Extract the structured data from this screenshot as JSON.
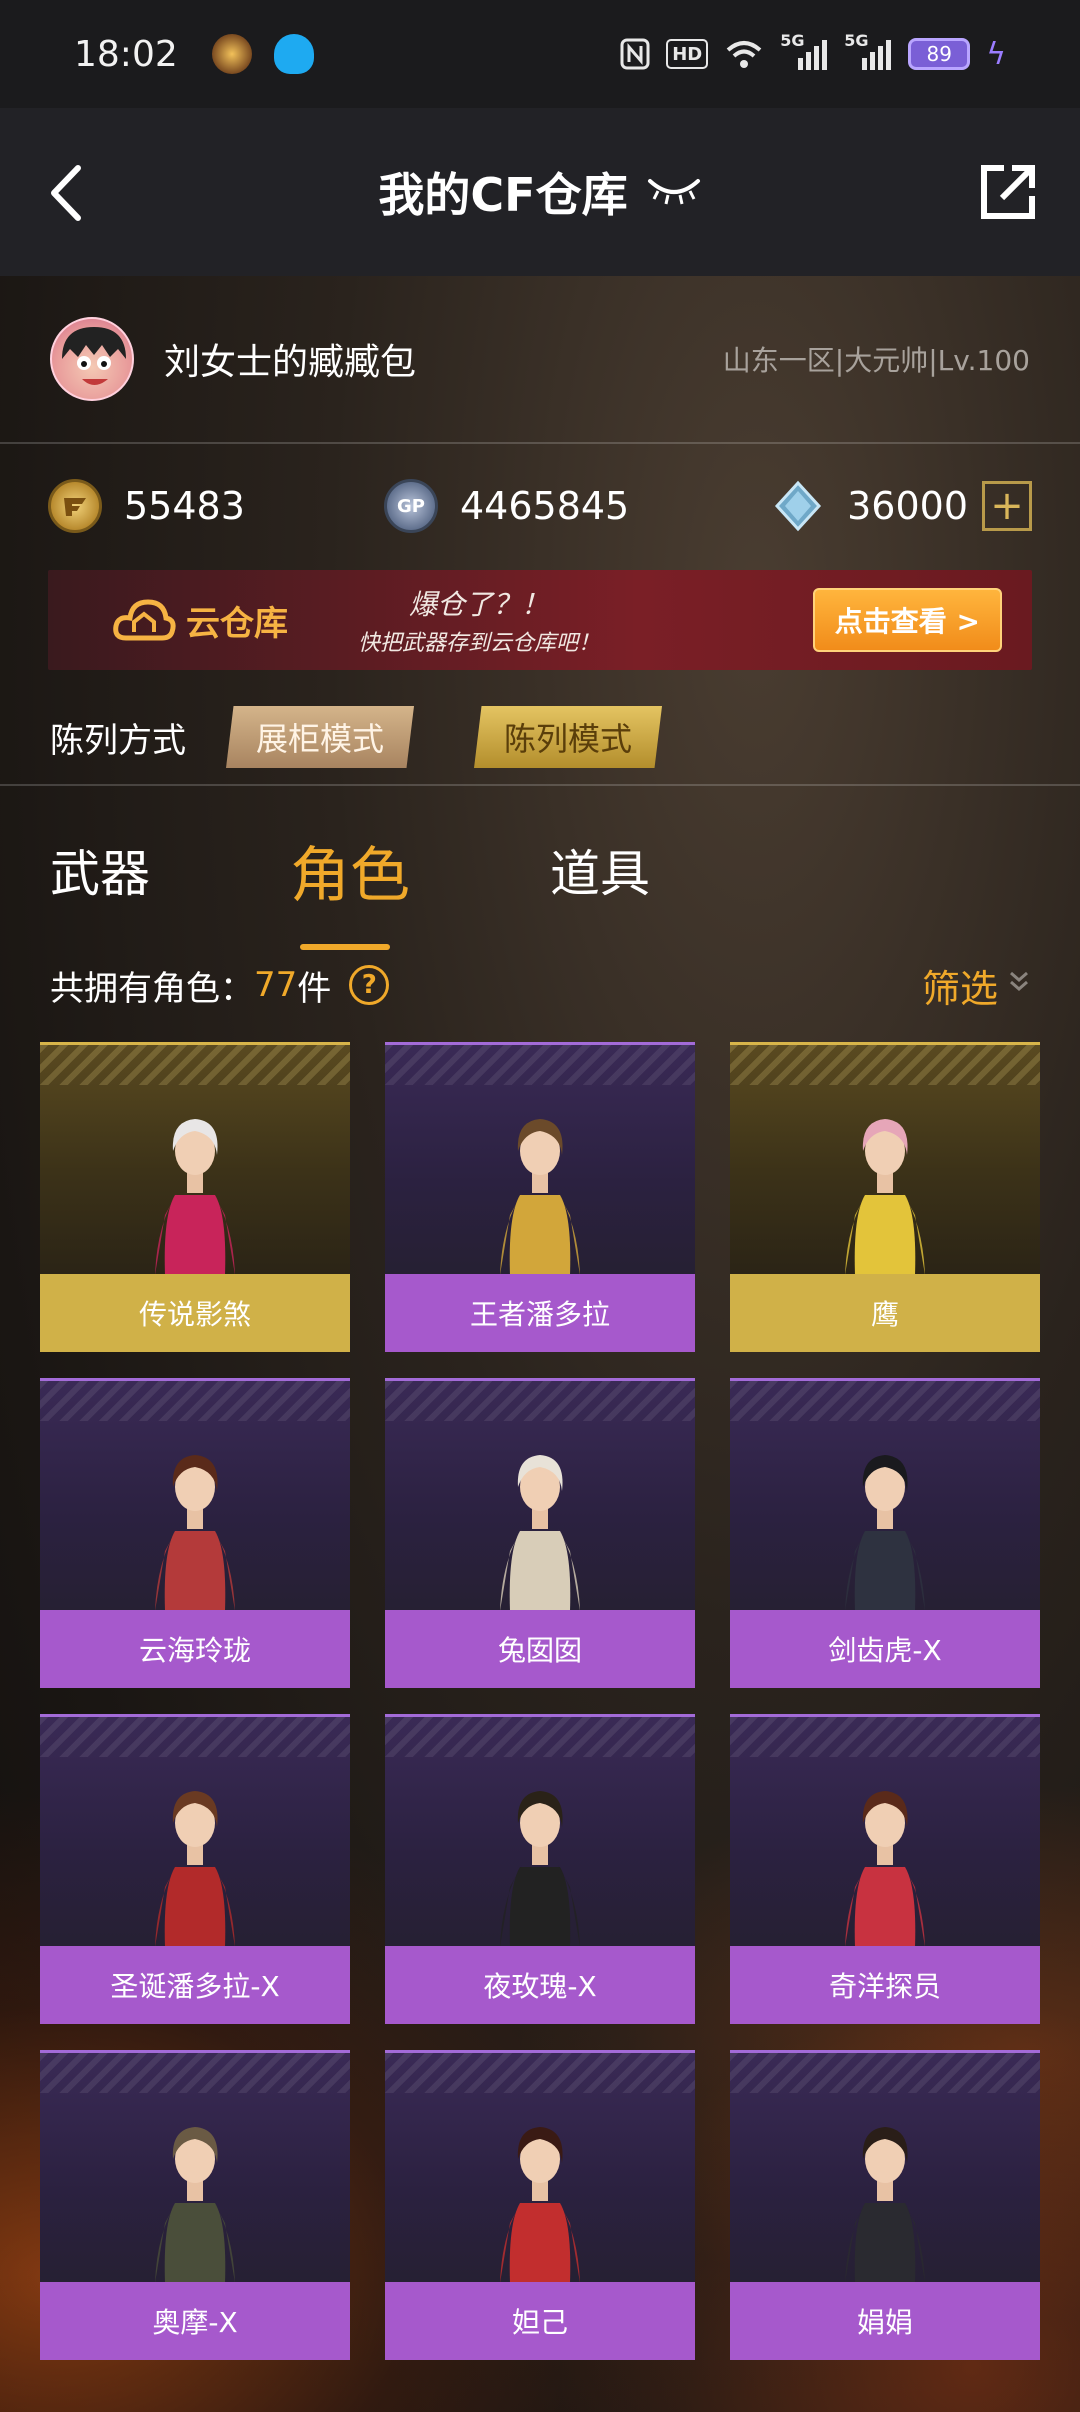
{
  "status_bar": {
    "time": "18:02",
    "hd_label": "HD",
    "net1": "5G",
    "net2": "5G",
    "battery": "89"
  },
  "header": {
    "title": "我的CF仓库"
  },
  "profile": {
    "name": "刘女士的臧臧包",
    "server": "山东一区|大元帅|Lv.100"
  },
  "currency": {
    "cf_points": "55483",
    "gp": "4465845",
    "diamonds": "36000",
    "gp_icon_text": "GP"
  },
  "banner": {
    "cloud_label": "云仓库",
    "line1": "爆仓了？！",
    "line2": "快把武器存到云仓库吧！",
    "button": "点击查看 >"
  },
  "display_mode": {
    "label": "陈列方式",
    "cabinet": "展柜模式",
    "list": "陈列模式"
  },
  "tabs": {
    "weapon": "武器",
    "role": "角色",
    "item": "道具"
  },
  "count": {
    "label": "共拥有角色：",
    "num": "77",
    "unit": "件",
    "help": "?",
    "filter": "筛选"
  },
  "roles": [
    {
      "name": "传说影煞",
      "rarity": "gold",
      "hair": "#e8e6e6",
      "outfit": "#c8245a"
    },
    {
      "name": "王者潘多拉",
      "rarity": "purple",
      "hair": "#6b4a2a",
      "outfit": "#d2a63a"
    },
    {
      "name": "鹰",
      "rarity": "gold",
      "hair": "#e6a6b8",
      "outfit": "#e3c43a"
    },
    {
      "name": "云海玲珑",
      "rarity": "purple",
      "hair": "#5a2a1a",
      "outfit": "#b43a3a"
    },
    {
      "name": "兔囡囡",
      "rarity": "purple",
      "hair": "#e8e2d8",
      "outfit": "#d8cdb8"
    },
    {
      "name": "剑齿虎-X",
      "rarity": "purple",
      "hair": "#1a1a1e",
      "outfit": "#2e3240"
    },
    {
      "name": "圣诞潘多拉-X",
      "rarity": "purple",
      "hair": "#6a3a22",
      "outfit": "#b22a2a"
    },
    {
      "name": "夜玫瑰-X",
      "rarity": "purple",
      "hair": "#2a2218",
      "outfit": "#222222"
    },
    {
      "name": "奇洋探员",
      "rarity": "purple",
      "hair": "#5a2a1a",
      "outfit": "#c83240"
    },
    {
      "name": "奥摩-X",
      "rarity": "purple",
      "hair": "#6a5a44",
      "outfit": "#4a4e3a"
    },
    {
      "name": "妲己",
      "rarity": "purple",
      "hair": "#3a1a14",
      "outfit": "#c22e2e"
    },
    {
      "name": "娟娟",
      "rarity": "purple",
      "hair": "#2a1e18",
      "outfit": "#2a2a30"
    }
  ]
}
